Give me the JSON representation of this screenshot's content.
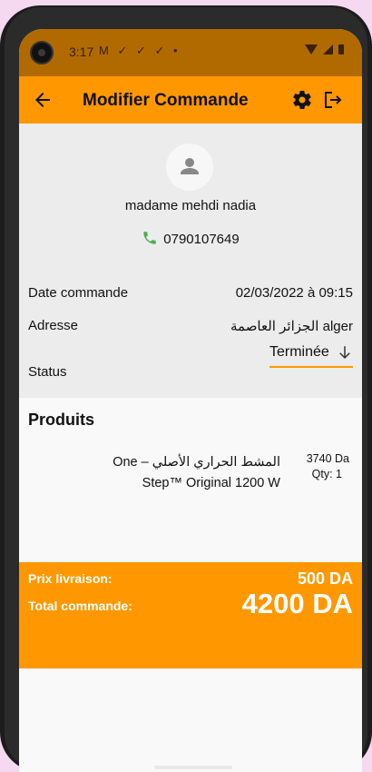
{
  "statusbar": {
    "time": "3:17",
    "notification_icons": "M ✓ ✓ ✓ •"
  },
  "appbar": {
    "title": "Modifier Commande",
    "back_icon": "arrow-left-icon",
    "settings_icon": "gear-icon",
    "logout_icon": "logout-icon"
  },
  "customer": {
    "name": "madame mehdi nadia",
    "phone": "0790107649"
  },
  "order": {
    "date_label": "Date commande",
    "date_value": "02/03/2022 à 09:15",
    "address_label": "Adresse",
    "address_value": "الجزائر العاصمة alger",
    "status_label": "Status",
    "status_value": "Terminée"
  },
  "products": {
    "title": "Produits",
    "items": [
      {
        "name": "المشط الحراري الأصلي – One Step™ Original 1200 W",
        "price": "3740 Da",
        "qty": "Qty: 1"
      }
    ]
  },
  "totals": {
    "delivery_label": "Prix livraison:",
    "delivery_value": "500 DA",
    "total_label": "Total commande:",
    "total_value": "4200 DA"
  },
  "colors": {
    "accent": "#ff9800",
    "statusbar": "#b06a00",
    "header_bg": "#ececec",
    "phone_icon": "#4caf50"
  }
}
